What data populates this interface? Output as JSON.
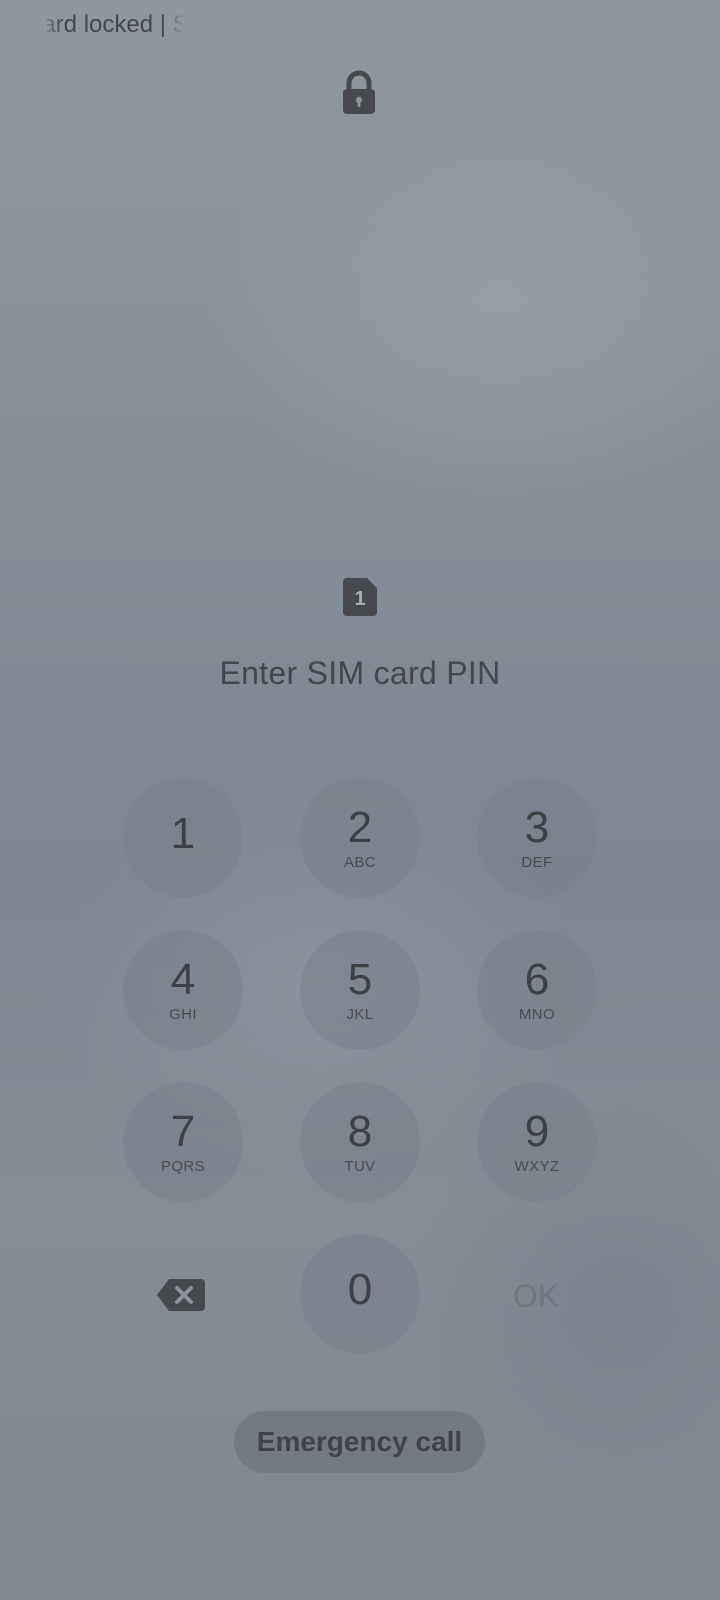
{
  "status_bar": {
    "carrier_text": "Card locked | S"
  },
  "lock": {
    "icon": "lock-icon"
  },
  "sim": {
    "icon": "sim-card-icon",
    "slot_number": "1"
  },
  "prompt": {
    "text": "Enter SIM card PIN"
  },
  "keypad": {
    "keys": [
      {
        "digit": "1",
        "letters": ""
      },
      {
        "digit": "2",
        "letters": "ABC"
      },
      {
        "digit": "3",
        "letters": "DEF"
      },
      {
        "digit": "4",
        "letters": "GHI"
      },
      {
        "digit": "5",
        "letters": "JKL"
      },
      {
        "digit": "6",
        "letters": "MNO"
      },
      {
        "digit": "7",
        "letters": "PQRS"
      },
      {
        "digit": "8",
        "letters": "TUV"
      },
      {
        "digit": "9",
        "letters": "WXYZ"
      },
      {
        "digit": "0",
        "letters": ""
      }
    ],
    "backspace_icon": "backspace-icon",
    "ok_label": "OK"
  },
  "emergency": {
    "label": "Emergency call"
  },
  "colors": {
    "key_text": "#3d4044",
    "ok_disabled": "#70767d",
    "icon_fill": "#46494d"
  }
}
